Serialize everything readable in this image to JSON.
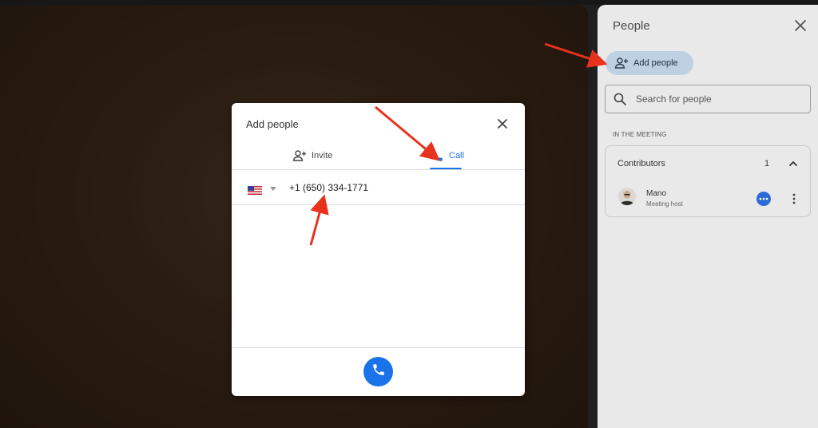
{
  "people_panel": {
    "title": "People",
    "add_people_label": "Add people",
    "search_placeholder": "Search for people",
    "section_label": "IN THE MEETING",
    "contributors": {
      "title": "Contributors",
      "count": "1",
      "people": [
        {
          "name": "Mano",
          "role": "Meeting host"
        }
      ]
    }
  },
  "dialog": {
    "title": "Add people",
    "tabs": [
      {
        "label": "Invite",
        "icon": "person-add-icon",
        "active": false
      },
      {
        "label": "Call",
        "icon": "phone-icon",
        "active": true
      }
    ],
    "country_flag": "us-flag-icon",
    "phone_value": "+1 (650) 334-1771",
    "call_button_icon": "phone-icon"
  },
  "colors": {
    "accent": "#1a73e8",
    "annotation_arrow": "#e8321e",
    "add_people_chip": "#bdd1e3",
    "panel_bg": "#e9e9ea"
  }
}
